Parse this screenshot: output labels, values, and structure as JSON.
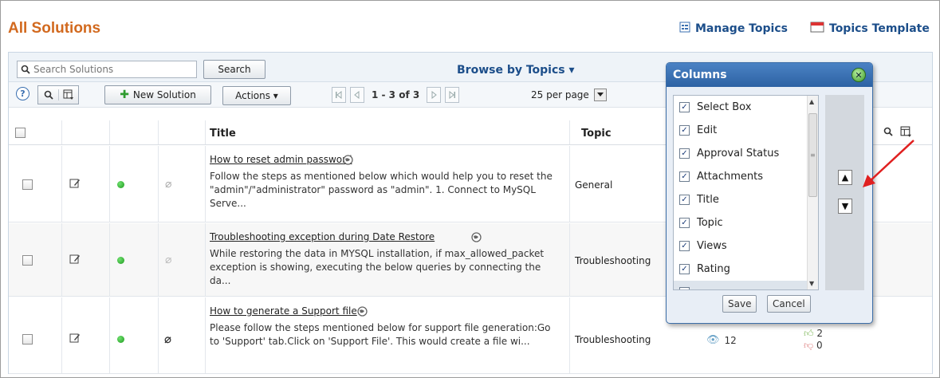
{
  "page": {
    "title": "All Solutions",
    "manage_topics": "Manage Topics",
    "topics_template": "Topics Template"
  },
  "toolbar": {
    "search_placeholder": "Search Solutions",
    "search_button": "Search",
    "browse_by_topics": "Browse by Topics ▾",
    "new_solution": "New Solution",
    "actions": "Actions ▾",
    "pager_text": "1 - 3 of 3",
    "per_page": "25 per page"
  },
  "table": {
    "headers": {
      "title": "Title",
      "topic": "Topic"
    },
    "rows": [
      {
        "title": "How to reset admin password",
        "description": "Follow the steps as mentioned below which would help you to reset the \"admin\"/\"administrator\" password as \"admin\". 1. Connect to MySQL Serve...",
        "topic": "General"
      },
      {
        "title": "Troubleshooting exception during Date Restore",
        "description": "While restoring the data in MYSQL installation, if max_allowed_packet exception is showing, executing the below queries by connecting the da...",
        "topic": "Troubleshooting"
      },
      {
        "title": "How to generate a Support file",
        "description": "Please follow the steps mentioned below for support file generation:Go to 'Support' tab.Click on 'Support File'. This would create a file wi...",
        "topic": "Troubleshooting",
        "views": "12",
        "likes": "2",
        "dislikes": "0"
      }
    ]
  },
  "columns_dialog": {
    "title": "Columns",
    "items": [
      "Select Box",
      "Edit",
      "Approval Status",
      "Attachments",
      "Title",
      "Topic",
      "Views",
      "Rating"
    ],
    "save": "Save",
    "cancel": "Cancel"
  },
  "colors": {
    "accent": "#d2691e",
    "link": "#1c4e8a",
    "dialog_header": "#2d62a3",
    "annotation_arrow": "#e02020"
  }
}
